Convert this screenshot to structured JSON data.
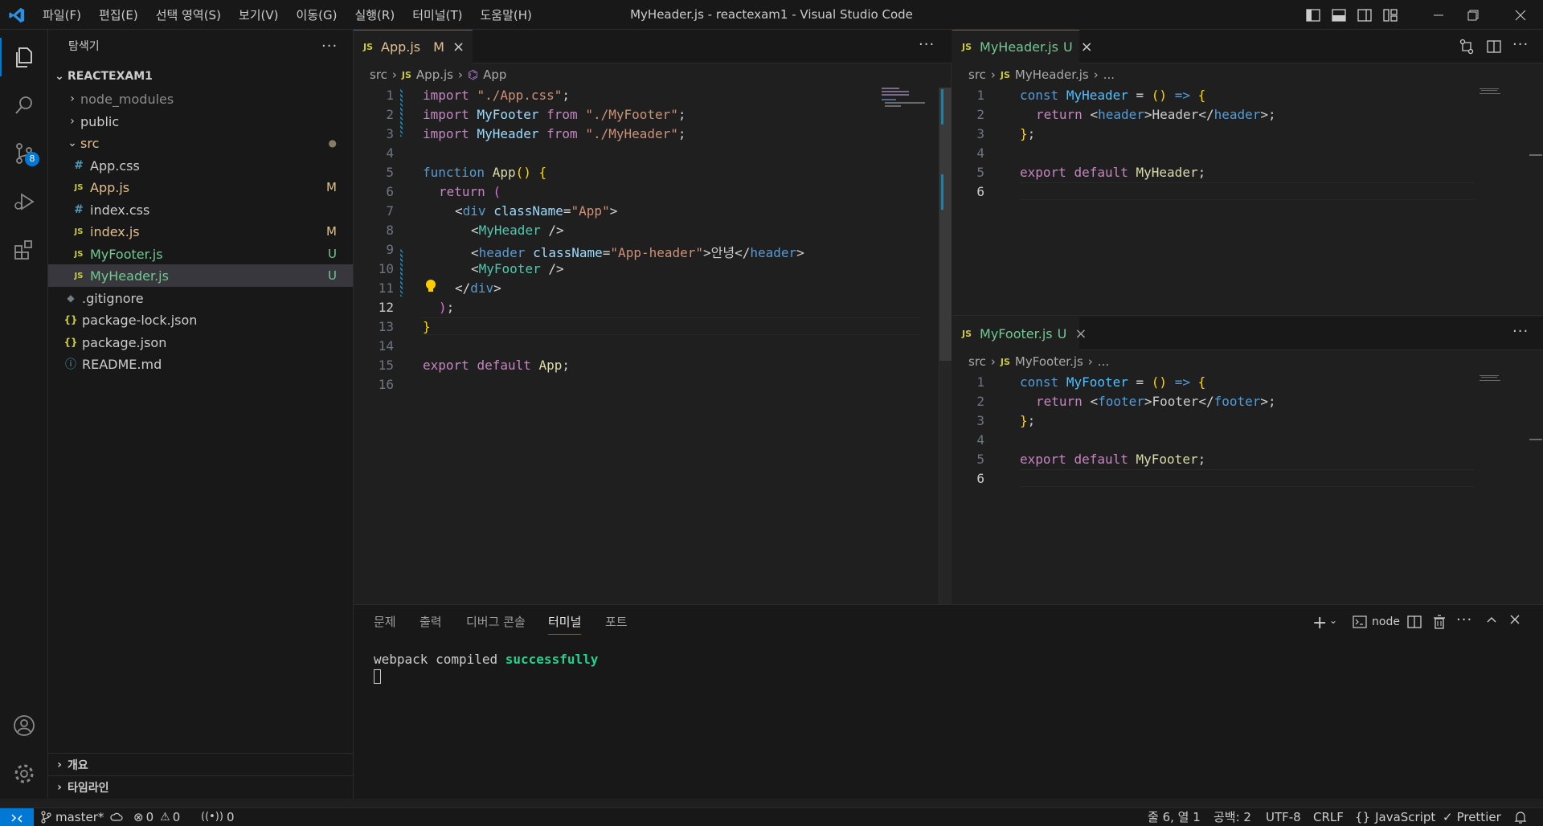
{
  "window": {
    "title": "MyHeader.js - reactexam1 - Visual Studio Code"
  },
  "menu": [
    "파일(F)",
    "편집(E)",
    "선택 영역(S)",
    "보기(V)",
    "이동(G)",
    "실행(R)",
    "터미널(T)",
    "도움말(H)"
  ],
  "activity": {
    "scm_badge": "8"
  },
  "sidebar": {
    "title": "탐색기",
    "project": "REACTEXAM1",
    "items": [
      {
        "label": "node_modules",
        "icon": "chevron-right",
        "decoration": ""
      },
      {
        "label": "public",
        "icon": "chevron-right",
        "decoration": ""
      },
      {
        "label": "src",
        "icon": "chevron-down",
        "decoration": "●"
      },
      {
        "label": "App.css",
        "icon": "#",
        "decoration": ""
      },
      {
        "label": "App.js",
        "icon": "JS",
        "decoration": "M"
      },
      {
        "label": "index.css",
        "icon": "#",
        "decoration": ""
      },
      {
        "label": "index.js",
        "icon": "JS",
        "decoration": "M"
      },
      {
        "label": "MyFooter.js",
        "icon": "JS",
        "decoration": "U"
      },
      {
        "label": "MyHeader.js",
        "icon": "JS",
        "decoration": "U"
      },
      {
        "label": ".gitignore",
        "icon": "◆",
        "decoration": ""
      },
      {
        "label": "package-lock.json",
        "icon": "{}",
        "decoration": ""
      },
      {
        "label": "package.json",
        "icon": "{}",
        "decoration": ""
      },
      {
        "label": "README.md",
        "icon": "ⓘ",
        "decoration": ""
      }
    ],
    "outline": "개요",
    "timeline": "타임라인"
  },
  "editor_left": {
    "tab": {
      "label": "App.js",
      "status": "M"
    },
    "breadcrumb": [
      "src",
      "App.js",
      "App"
    ],
    "line_numbers": [
      "1",
      "2",
      "3",
      "4",
      "5",
      "6",
      "7",
      "8",
      "9",
      "10",
      "11",
      "12",
      "13",
      "14",
      "15",
      "16"
    ]
  },
  "editor_right_top": {
    "tab": {
      "label": "MyHeader.js",
      "status": "U"
    },
    "breadcrumb": [
      "src",
      "MyHeader.js",
      "..."
    ],
    "line_numbers": [
      "1",
      "2",
      "3",
      "4",
      "5",
      "6"
    ]
  },
  "editor_right_bottom": {
    "tab": {
      "label": "MyFooter.js",
      "status": "U"
    },
    "breadcrumb": [
      "src",
      "MyFooter.js",
      "..."
    ],
    "line_numbers": [
      "1",
      "2",
      "3",
      "4",
      "5",
      "6"
    ]
  },
  "code": {
    "import": "import",
    "from": "from",
    "app_css": "\"./App.css\"",
    "myfooter": "MyFooter",
    "myfooter_path": "\"./MyFooter\"",
    "myheader": "MyHeader",
    "myheader_path": "\"./MyHeader\"",
    "function": "function",
    "app": "App",
    "return": "return",
    "div": "div",
    "classname": "className",
    "app_str": "\"App\"",
    "header": "header",
    "app_header_str": "\"App-header\"",
    "hello": "안녕",
    "export": "export",
    "default": "default",
    "const": "const",
    "header_text": "Header",
    "footer": "footer",
    "footer_text": "Footer"
  },
  "panel": {
    "tabs": [
      "문제",
      "출력",
      "디버그 콘솔",
      "터미널",
      "포트"
    ],
    "active_tab": "터미널",
    "terminal_name": "node",
    "output_prefix": "webpack compiled ",
    "output_success": "successfully"
  },
  "status": {
    "branch": "master*",
    "errors": "0",
    "warnings": "0",
    "ports": "0",
    "position": "줄 6, 열 1",
    "spaces": "공백: 2",
    "encoding": "UTF-8",
    "eol": "CRLF",
    "language": "JavaScript",
    "formatter": "Prettier"
  },
  "colors": {
    "accent": "#0078d4",
    "modified": "#e2c08d",
    "untracked": "#73c991",
    "js_icon": "#cbcb41",
    "success": "#23d18b"
  }
}
